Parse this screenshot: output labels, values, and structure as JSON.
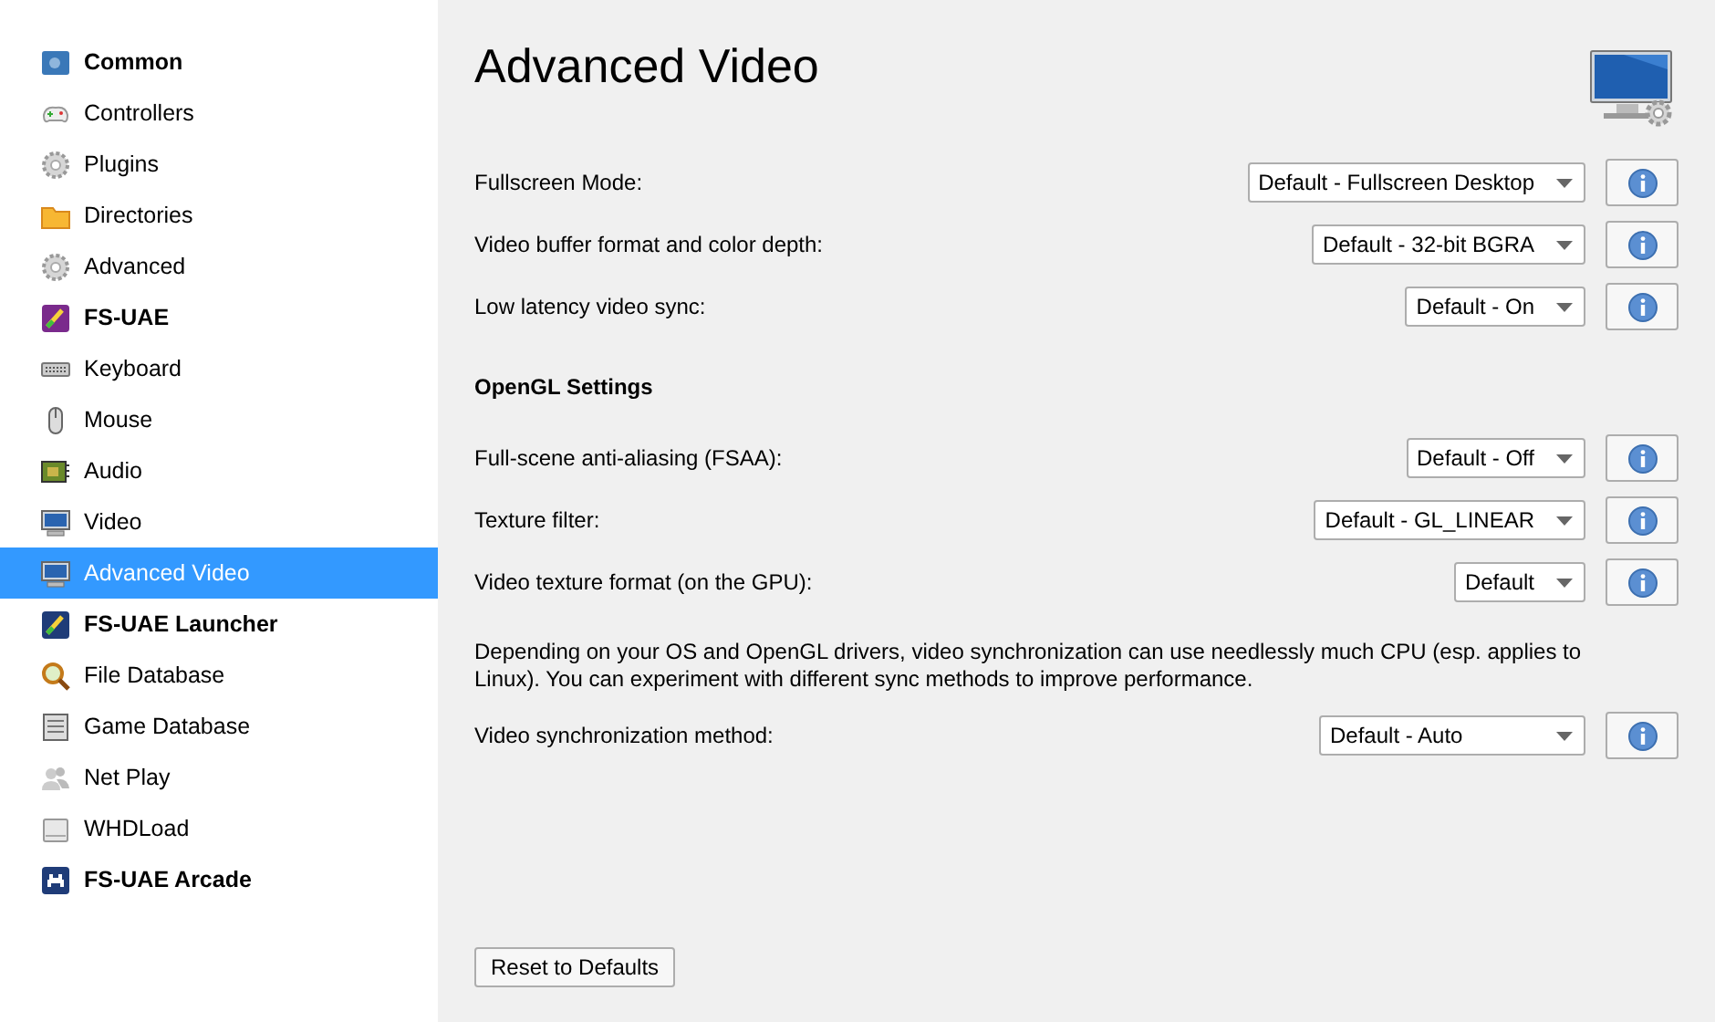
{
  "sidebar": {
    "items": [
      {
        "label": "Common",
        "kind": "group",
        "selected": false
      },
      {
        "label": "Controllers",
        "kind": "page",
        "selected": false
      },
      {
        "label": "Plugins",
        "kind": "page",
        "selected": false
      },
      {
        "label": "Directories",
        "kind": "page",
        "selected": false
      },
      {
        "label": "Advanced",
        "kind": "page",
        "selected": false
      },
      {
        "label": "FS-UAE",
        "kind": "group",
        "selected": false
      },
      {
        "label": "Keyboard",
        "kind": "page",
        "selected": false
      },
      {
        "label": "Mouse",
        "kind": "page",
        "selected": false
      },
      {
        "label": "Audio",
        "kind": "page",
        "selected": false
      },
      {
        "label": "Video",
        "kind": "page",
        "selected": false
      },
      {
        "label": "Advanced Video",
        "kind": "page",
        "selected": true
      },
      {
        "label": "FS-UAE Launcher",
        "kind": "group",
        "selected": false
      },
      {
        "label": "File Database",
        "kind": "page",
        "selected": false
      },
      {
        "label": "Game Database",
        "kind": "page",
        "selected": false
      },
      {
        "label": "Net Play",
        "kind": "page",
        "selected": false
      },
      {
        "label": "WHDLoad",
        "kind": "page",
        "selected": false
      },
      {
        "label": "FS-UAE Arcade",
        "kind": "group",
        "selected": false
      }
    ]
  },
  "page": {
    "title": "Advanced Video",
    "rows": [
      {
        "kind": "select",
        "label": "Fullscreen Mode:",
        "value": "Default - Fullscreen Desktop"
      },
      {
        "kind": "select",
        "label": "Video buffer format and color depth:",
        "value": "Default - 32-bit BGRA"
      },
      {
        "kind": "select",
        "label": "Low latency video sync:",
        "value": "Default - On"
      },
      {
        "kind": "heading",
        "label": "OpenGL Settings"
      },
      {
        "kind": "select",
        "label": "Full-scene anti-aliasing (FSAA):",
        "value": "Default - Off"
      },
      {
        "kind": "select",
        "label": "Texture filter:",
        "value": "Default - GL_LINEAR"
      },
      {
        "kind": "select",
        "label": "Video texture format (on the GPU):",
        "value": "Default"
      },
      {
        "kind": "note",
        "label": "Depending on your OS and OpenGL drivers, video synchronization can use needlessly much CPU (esp. applies to Linux). You can experiment with different sync methods to improve performance."
      },
      {
        "kind": "select",
        "label": "Video synchronization method:",
        "value": "Default - Auto",
        "wide": true
      }
    ],
    "reset_button": "Reset to Defaults"
  }
}
